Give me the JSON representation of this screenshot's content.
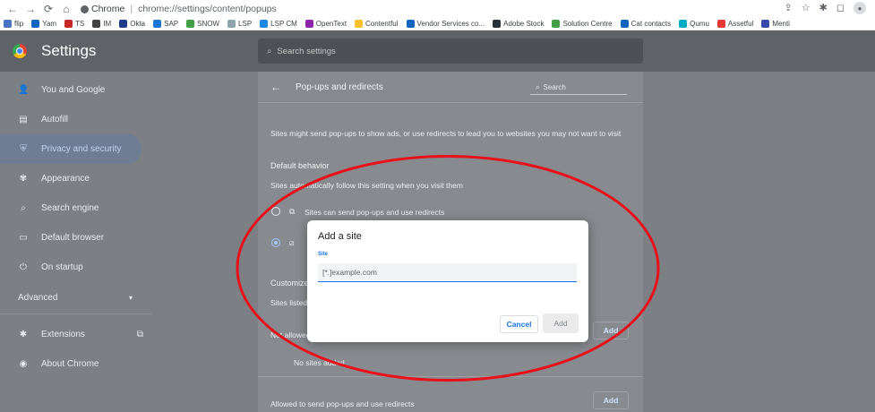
{
  "browser": {
    "site_chip": "Chrome",
    "url": "chrome://settings/content/popups"
  },
  "bookmarks": [
    {
      "label": "flip",
      "color": "#4a73c4"
    },
    {
      "label": "Yam",
      "color": "#1565c0"
    },
    {
      "label": "TS",
      "color": "#c62828"
    },
    {
      "label": "IM",
      "color": "#424242"
    },
    {
      "label": "Okta",
      "color": "#1e3a8a"
    },
    {
      "label": "SAP",
      "color": "#1976d2"
    },
    {
      "label": "SNOW",
      "color": "#43a047"
    },
    {
      "label": "LSP",
      "color": "#90a4ae"
    },
    {
      "label": "LSP CM",
      "color": "#1e88e5"
    },
    {
      "label": "OpenText",
      "color": "#8e24aa"
    },
    {
      "label": "Contentful",
      "color": "#fbc02d"
    },
    {
      "label": "Vendor Services co...",
      "color": "#1565c0"
    },
    {
      "label": "Adobe Stock",
      "color": "#263238"
    },
    {
      "label": "Solution Centre",
      "color": "#43a047"
    },
    {
      "label": "Cat contacts",
      "color": "#1565c0"
    },
    {
      "label": "Qumu",
      "color": "#00acc1"
    },
    {
      "label": "Assetful",
      "color": "#e53935"
    },
    {
      "label": "Menti",
      "color": "#3949ab"
    }
  ],
  "header": {
    "title": "Settings",
    "search_placeholder": "Search settings"
  },
  "sidebar": {
    "items": [
      {
        "label": "You and Google",
        "icon": "person-icon",
        "glyph": "👤"
      },
      {
        "label": "Autofill",
        "icon": "clipboard-icon",
        "glyph": "▤"
      },
      {
        "label": "Privacy and security",
        "icon": "shield-icon",
        "glyph": "⛨"
      },
      {
        "label": "Appearance",
        "icon": "palette-icon",
        "glyph": "✾"
      },
      {
        "label": "Search engine",
        "icon": "search-icon",
        "glyph": "⌕"
      },
      {
        "label": "Default browser",
        "icon": "browser-window-icon",
        "glyph": "▭"
      },
      {
        "label": "On startup",
        "icon": "power-icon",
        "glyph": "⏻"
      }
    ],
    "advanced": "Advanced",
    "extensions": "Extensions",
    "about": "About Chrome"
  },
  "content": {
    "title": "Pop-ups and redirects",
    "search": "Search",
    "description": "Sites might send pop-ups to show ads, or use redirects to lead you to websites you may not want to visit",
    "default_behavior": "Default behavior",
    "default_sub": "Sites automatically follow this setting when you visit them",
    "option_allow": "Sites can send pop-ups and use redirects",
    "customized": "Customized behaviors",
    "sites_listed": "Sites listed below follow a custom setting instead of the default",
    "not_allowed": "Not allowed to send pop-ups or use redirects",
    "no_sites": "No sites added",
    "allowed": "Allowed to send pop-ups and use redirects",
    "add_label": "Add"
  },
  "dialog": {
    "title": "Add a site",
    "field_label": "Site",
    "input_value": "[*.]example.com",
    "cancel": "Cancel",
    "add": "Add"
  },
  "colors": {
    "annotation": "#e8101a",
    "accent": "#1a73e8"
  }
}
